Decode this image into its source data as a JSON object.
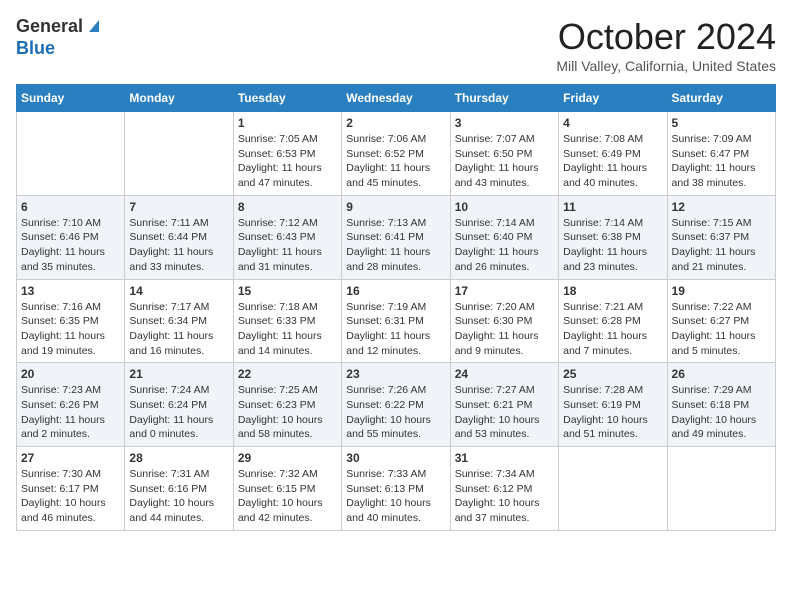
{
  "header": {
    "logo_general": "General",
    "logo_blue": "Blue",
    "month_title": "October 2024",
    "location": "Mill Valley, California, United States"
  },
  "days_of_week": [
    "Sunday",
    "Monday",
    "Tuesday",
    "Wednesday",
    "Thursday",
    "Friday",
    "Saturday"
  ],
  "weeks": [
    [
      null,
      null,
      {
        "date": "1",
        "sunrise": "7:05 AM",
        "sunset": "6:53 PM",
        "daylight": "11 hours and 47 minutes."
      },
      {
        "date": "2",
        "sunrise": "7:06 AM",
        "sunset": "6:52 PM",
        "daylight": "11 hours and 45 minutes."
      },
      {
        "date": "3",
        "sunrise": "7:07 AM",
        "sunset": "6:50 PM",
        "daylight": "11 hours and 43 minutes."
      },
      {
        "date": "4",
        "sunrise": "7:08 AM",
        "sunset": "6:49 PM",
        "daylight": "11 hours and 40 minutes."
      },
      {
        "date": "5",
        "sunrise": "7:09 AM",
        "sunset": "6:47 PM",
        "daylight": "11 hours and 38 minutes."
      }
    ],
    [
      {
        "date": "6",
        "sunrise": "7:10 AM",
        "sunset": "6:46 PM",
        "daylight": "11 hours and 35 minutes."
      },
      {
        "date": "7",
        "sunrise": "7:11 AM",
        "sunset": "6:44 PM",
        "daylight": "11 hours and 33 minutes."
      },
      {
        "date": "8",
        "sunrise": "7:12 AM",
        "sunset": "6:43 PM",
        "daylight": "11 hours and 31 minutes."
      },
      {
        "date": "9",
        "sunrise": "7:13 AM",
        "sunset": "6:41 PM",
        "daylight": "11 hours and 28 minutes."
      },
      {
        "date": "10",
        "sunrise": "7:14 AM",
        "sunset": "6:40 PM",
        "daylight": "11 hours and 26 minutes."
      },
      {
        "date": "11",
        "sunrise": "7:14 AM",
        "sunset": "6:38 PM",
        "daylight": "11 hours and 23 minutes."
      },
      {
        "date": "12",
        "sunrise": "7:15 AM",
        "sunset": "6:37 PM",
        "daylight": "11 hours and 21 minutes."
      }
    ],
    [
      {
        "date": "13",
        "sunrise": "7:16 AM",
        "sunset": "6:35 PM",
        "daylight": "11 hours and 19 minutes."
      },
      {
        "date": "14",
        "sunrise": "7:17 AM",
        "sunset": "6:34 PM",
        "daylight": "11 hours and 16 minutes."
      },
      {
        "date": "15",
        "sunrise": "7:18 AM",
        "sunset": "6:33 PM",
        "daylight": "11 hours and 14 minutes."
      },
      {
        "date": "16",
        "sunrise": "7:19 AM",
        "sunset": "6:31 PM",
        "daylight": "11 hours and 12 minutes."
      },
      {
        "date": "17",
        "sunrise": "7:20 AM",
        "sunset": "6:30 PM",
        "daylight": "11 hours and 9 minutes."
      },
      {
        "date": "18",
        "sunrise": "7:21 AM",
        "sunset": "6:28 PM",
        "daylight": "11 hours and 7 minutes."
      },
      {
        "date": "19",
        "sunrise": "7:22 AM",
        "sunset": "6:27 PM",
        "daylight": "11 hours and 5 minutes."
      }
    ],
    [
      {
        "date": "20",
        "sunrise": "7:23 AM",
        "sunset": "6:26 PM",
        "daylight": "11 hours and 2 minutes."
      },
      {
        "date": "21",
        "sunrise": "7:24 AM",
        "sunset": "6:24 PM",
        "daylight": "11 hours and 0 minutes."
      },
      {
        "date": "22",
        "sunrise": "7:25 AM",
        "sunset": "6:23 PM",
        "daylight": "10 hours and 58 minutes."
      },
      {
        "date": "23",
        "sunrise": "7:26 AM",
        "sunset": "6:22 PM",
        "daylight": "10 hours and 55 minutes."
      },
      {
        "date": "24",
        "sunrise": "7:27 AM",
        "sunset": "6:21 PM",
        "daylight": "10 hours and 53 minutes."
      },
      {
        "date": "25",
        "sunrise": "7:28 AM",
        "sunset": "6:19 PM",
        "daylight": "10 hours and 51 minutes."
      },
      {
        "date": "26",
        "sunrise": "7:29 AM",
        "sunset": "6:18 PM",
        "daylight": "10 hours and 49 minutes."
      }
    ],
    [
      {
        "date": "27",
        "sunrise": "7:30 AM",
        "sunset": "6:17 PM",
        "daylight": "10 hours and 46 minutes."
      },
      {
        "date": "28",
        "sunrise": "7:31 AM",
        "sunset": "6:16 PM",
        "daylight": "10 hours and 44 minutes."
      },
      {
        "date": "29",
        "sunrise": "7:32 AM",
        "sunset": "6:15 PM",
        "daylight": "10 hours and 42 minutes."
      },
      {
        "date": "30",
        "sunrise": "7:33 AM",
        "sunset": "6:13 PM",
        "daylight": "10 hours and 40 minutes."
      },
      {
        "date": "31",
        "sunrise": "7:34 AM",
        "sunset": "6:12 PM",
        "daylight": "10 hours and 37 minutes."
      },
      null,
      null
    ]
  ]
}
